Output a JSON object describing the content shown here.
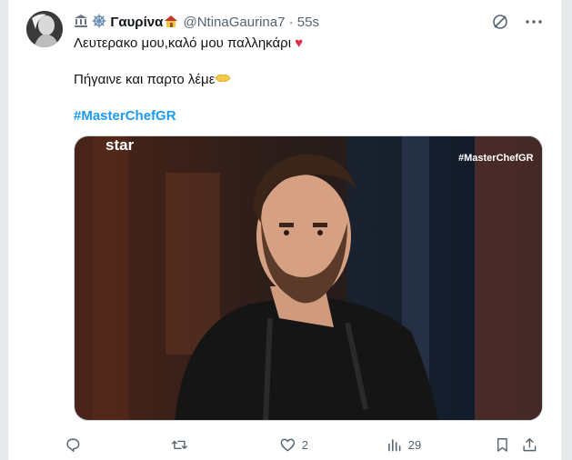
{
  "tweet": {
    "display_name": "Γαυρίνα",
    "handle": "@NtinaGaurina7",
    "separator": "·",
    "time": "55s",
    "line1": "Λευτερακο μου,καλό μου παλληκάρι",
    "line1_emoji": "♥",
    "line2": "Πήγαινε και παρτο λέμε",
    "hashtag": "#MasterChefGR"
  },
  "media": {
    "channel_logo": "star",
    "overlay_hashtag": "#MasterChefGR"
  },
  "actions": {
    "reply_count": "",
    "retweet_count": "",
    "like_count": "2",
    "views_count": "29"
  },
  "colors": {
    "accent": "#1d9bf0",
    "muted": "#536471",
    "heart": "#dd2e44"
  },
  "icons": [
    "bank-icon",
    "ship-wheel-icon",
    "house-icon",
    "grok-icon",
    "more-icon",
    "reply-icon",
    "retweet-icon",
    "like-icon",
    "views-icon",
    "bookmark-icon",
    "share-icon"
  ]
}
